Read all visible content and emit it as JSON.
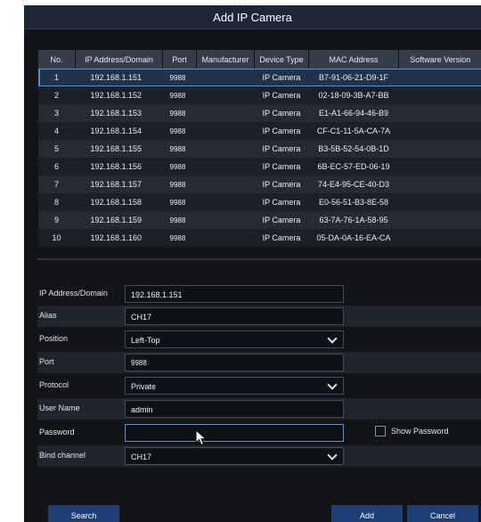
{
  "title": "Add IP Camera",
  "table": {
    "headers": [
      "No.",
      "IP Address/Domain",
      "Port",
      "Manufacturer",
      "Device Type",
      "MAC Address",
      "Software Version"
    ],
    "rows": [
      {
        "no": "1",
        "ip": "192.168.1.151",
        "port": "9988",
        "manufacturer": "",
        "type": "IP Camera",
        "mac": "B7-91-06-21-D9-1F",
        "version": ""
      },
      {
        "no": "2",
        "ip": "192.168.1.152",
        "port": "9988",
        "manufacturer": "",
        "type": "IP Camera",
        "mac": "02-18-09-3B-A7-BB",
        "version": ""
      },
      {
        "no": "3",
        "ip": "192.168.1.153",
        "port": "9988",
        "manufacturer": "",
        "type": "IP Camera",
        "mac": "E1-A1-66-94-46-B9",
        "version": ""
      },
      {
        "no": "4",
        "ip": "192.168.1.154",
        "port": "9988",
        "manufacturer": "",
        "type": "IP Camera",
        "mac": "CF-C1-11-5A-CA-7A",
        "version": ""
      },
      {
        "no": "5",
        "ip": "192.168.1.155",
        "port": "9988",
        "manufacturer": "",
        "type": "IP Camera",
        "mac": "B3-5B-52-54-0B-1D",
        "version": ""
      },
      {
        "no": "6",
        "ip": "192.168.1.156",
        "port": "9988",
        "manufacturer": "",
        "type": "IP Camera",
        "mac": "6B-EC-57-ED-06-19",
        "version": ""
      },
      {
        "no": "7",
        "ip": "192.168.1.157",
        "port": "9988",
        "manufacturer": "",
        "type": "IP Camera",
        "mac": "74-E4-95-CE-40-D3",
        "version": ""
      },
      {
        "no": "8",
        "ip": "192.168.1.158",
        "port": "9988",
        "manufacturer": "",
        "type": "IP Camera",
        "mac": "E0-56-51-B3-8E-58",
        "version": ""
      },
      {
        "no": "9",
        "ip": "192.168.1.159",
        "port": "9988",
        "manufacturer": "",
        "type": "IP Camera",
        "mac": "63-7A-76-1A-58-95",
        "version": ""
      },
      {
        "no": "10",
        "ip": "192.168.1.160",
        "port": "9988",
        "manufacturer": "",
        "type": "IP Camera",
        "mac": "05-DA-0A-16-EA-CA",
        "version": ""
      }
    ],
    "selected_row": 1
  },
  "form": {
    "ip_label": "IP Address/Domain",
    "ip_value": "192.168.1.151",
    "alias_label": "Alias",
    "alias_value": "CH17",
    "position_label": "Position",
    "position_value": "Left-Top",
    "port_label": "Port",
    "port_value": "9988",
    "protocol_label": "Protocol",
    "protocol_value": "Private",
    "username_label": "User Name",
    "username_value": "admin",
    "password_label": "Password",
    "password_value": "",
    "show_password_label": "Show Password",
    "show_password_checked": false,
    "bind_label": "Bind channel",
    "bind_value": "CH17"
  },
  "buttons": {
    "search": "Search",
    "add": "Add",
    "cancel": "Cancel"
  },
  "colors": {
    "background": "#121417",
    "title_bar": "#1c2636",
    "header": "#363d47",
    "selection": "#4a8fe0",
    "button": "#1e3f73"
  },
  "icons": [
    "chevron-down-icon",
    "mouse-cursor-icon",
    "checkbox-icon"
  ]
}
